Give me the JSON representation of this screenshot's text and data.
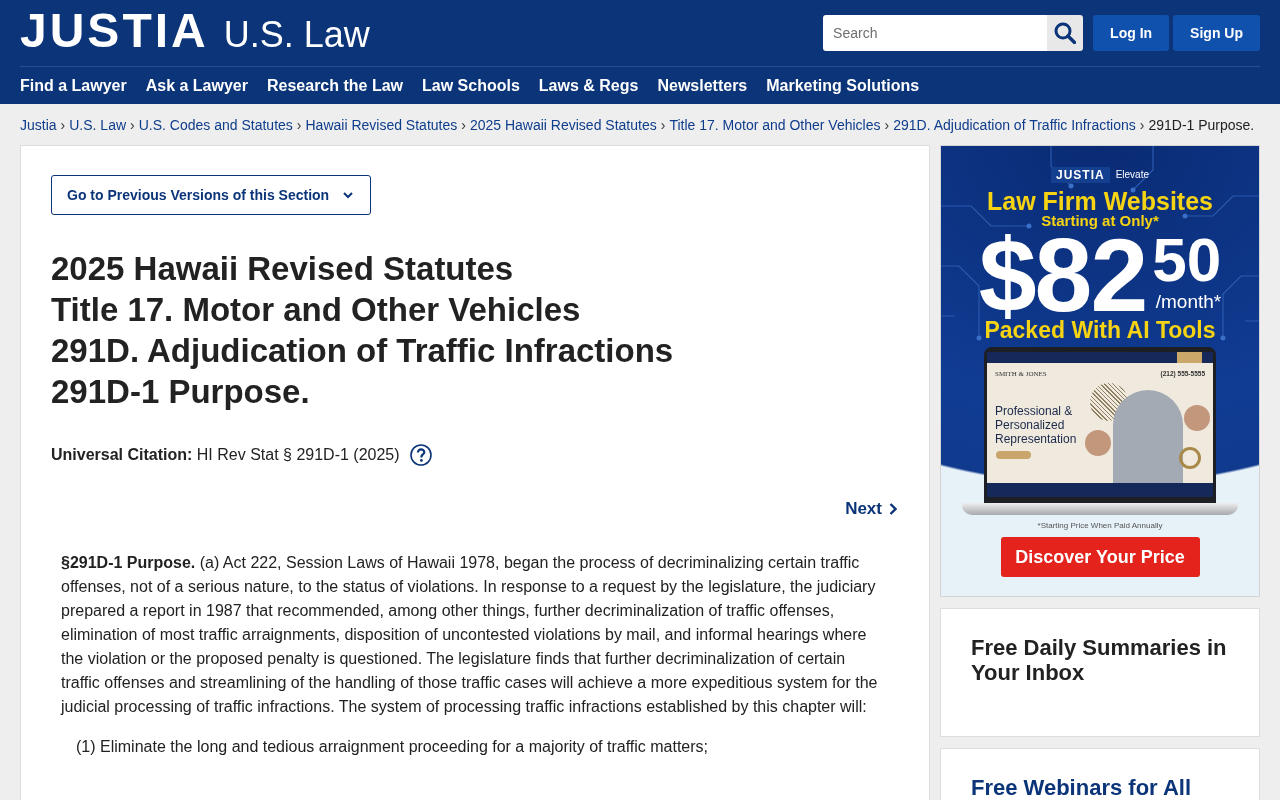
{
  "header": {
    "logo": "JUSTIA",
    "section": "U.S. Law",
    "search": {
      "placeholder": "Search"
    },
    "buttons": [
      "Log In",
      "Sign Up"
    ]
  },
  "nav": [
    "Find a Lawyer",
    "Ask a Lawyer",
    "Research the Law",
    "Law Schools",
    "Laws & Regs",
    "Newsletters",
    "Marketing Solutions"
  ],
  "breadcrumb": [
    {
      "label": "Justia",
      "separator": "›",
      "current": false
    },
    {
      "label": "U.S. Law",
      "separator": "›",
      "current": false
    },
    {
      "label": "U.S. Codes and Statutes",
      "separator": "›",
      "current": false
    },
    {
      "label": "Hawaii Revised Statutes",
      "separator": "›",
      "current": false
    },
    {
      "label": "2025 Hawaii Revised Statutes",
      "separator": "›",
      "current": false
    },
    {
      "label": "Title 17. Motor and Other Vehicles",
      "separator": "›",
      "current": false
    },
    {
      "label": "291D. Adjudication of Traffic Infractions",
      "separator": "›",
      "current": false
    },
    {
      "label": "291D-1 Purpose.",
      "current": true
    }
  ],
  "main": {
    "versions_button": "Go to Previous Versions of this Section",
    "title_lines": [
      "2025 Hawaii Revised Statutes",
      "Title 17. Motor and Other Vehicles",
      "291D. Adjudication of Traffic Infractions",
      "291D-1 Purpose."
    ],
    "citation": "**Universal Citation:** HI Rev Stat § 291D-1 (2025)",
    "next_link": "Next",
    "body": "**§291D-1 Purpose.** (a) Act 222, Session Laws of Hawaii 1978, began the process of decriminalizing certain traffic offenses, not of a serious nature, to the status of violations. In response to a request by the legislature, the judiciary prepared a report in 1987 that recommended, among other things, further decriminalization of traffic offenses, elimination of most traffic arraignments, disposition of uncontested violations by mail, and informal hearings where the violation or the proposed penalty is questioned. The legislature finds that further decriminalization of certain traffic offenses and streamlining of the handling of those traffic cases will achieve a more expeditious system for the judicial processing of traffic infractions. The system of processing traffic infractions established by this chapter will:",
    "list_items": [
      "(1) Eliminate the long and tedious arraignment proceeding for a majority of traffic matters;"
    ]
  },
  "sidebar": {
    "ad": {
      "brand": "JUSTIA",
      "brand_suffix": "Elevate",
      "headline": "Law Firm Websites",
      "subhead": "Starting at Only*",
      "price": "$82",
      "price_cents": "50",
      "price_period": "/month*",
      "tagline": "Packed With AI Tools",
      "laptop": {
        "firm_name": "SMITH & JONES",
        "phone": "(212) 555-5555",
        "headline": "Professional & Personalized Representation"
      },
      "footnote": "*Starting Price When Paid Annually",
      "cta": "Discover Your Price"
    },
    "cards": [
      {
        "kind": "heading",
        "title": "Free Daily Summaries in Your Inbox"
      },
      {
        "kind": "link",
        "title": "Free Webinars for All"
      }
    ]
  }
}
